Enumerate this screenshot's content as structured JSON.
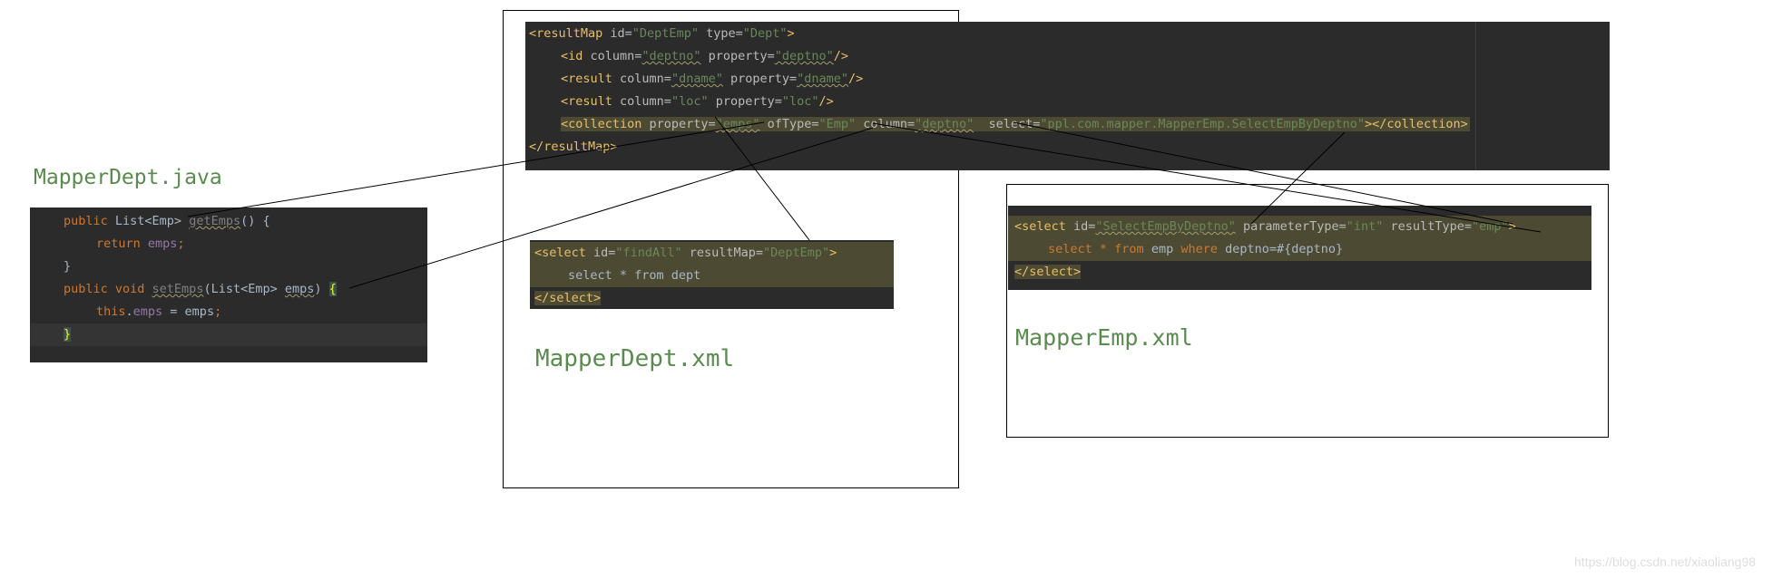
{
  "colors": {
    "editor_bg": "#2b2b2b",
    "tag": "#e8bf6a",
    "attr_name": "#bababa",
    "attr_value": "#6a8759",
    "keyword": "#cc7832",
    "field": "#9876aa",
    "plain": "#a9b7c6",
    "caption": "#5a8a4f"
  },
  "captions": {
    "java": "MapperDept.java",
    "dept_xml": "MapperDept.xml",
    "emp_xml": "MapperEmp.xml"
  },
  "result_map": {
    "l1_open": "<resultMap",
    "l1_id_attr": " id=",
    "l1_id_val": "\"DeptEmp\"",
    "l1_type_attr": " type=",
    "l1_type_val": "\"Dept\"",
    "l1_close": ">",
    "l2_open": "<id",
    "l2_col_attr": " column=",
    "l2_col_val": "\"deptno\"",
    "l2_prop_attr": " property=",
    "l2_prop_val": "\"deptno\"",
    "l2_close": "/>",
    "l3_open": "<result",
    "l3_col_attr": " column=",
    "l3_col_val": "\"dname\"",
    "l3_prop_attr": " property=",
    "l3_prop_val": "\"dname\"",
    "l3_close": "/>",
    "l4_open": "<result",
    "l4_col_attr": " column=",
    "l4_col_val": "\"loc\"",
    "l4_prop_attr": " property=",
    "l4_prop_val": "\"loc\"",
    "l4_close": "/>",
    "l5_open": "<collection",
    "l5_prop_attr": " property=",
    "l5_prop_val": "\"emps\"",
    "l5_of_attr": " ofType=",
    "l5_of_val": "\"Emp\"",
    "l5_col_attr": " column=",
    "l5_col_val": "\"deptno\"",
    "l5_sel_attr": "  select=",
    "l5_sel_val": "\"ppl.com.mapper.MapperEmp.SelectEmpByDeptno\"",
    "l5_close": "></collection>",
    "l6_close": "</resultMap>"
  },
  "java_code": {
    "l1_kw": "public ",
    "l1_type": "List<Emp> ",
    "l1_method": "getEmps",
    "l1_rest": "() {",
    "l2_kw": "return ",
    "l2_field": "emps",
    "l2_semi": ";",
    "l3": "}",
    "l4_kw": "public void ",
    "l4_method": "setEmps",
    "l4_params_open": "(List<Emp> ",
    "l4_param": "emps",
    "l4_params_close": ") ",
    "l4_brace": "{",
    "l5_kw": "this",
    "l5_dot": ".",
    "l5_field": "emps",
    "l5_rest": " = emps",
    "l5_semi": ";",
    "l6_brace": "}"
  },
  "select_findall": {
    "l1_open": "<select",
    "l1_id_attr": " id=",
    "l1_id_val": "\"findAll\"",
    "l1_rm_attr": " resultMap=",
    "l1_rm_val": "\"DeptEmp\"",
    "l1_close": ">",
    "l2": "select * from dept",
    "l3_close": "</select>"
  },
  "select_emp": {
    "l1_open": "<select",
    "l1_id_attr": " id=",
    "l1_id_val": "\"SelectEmpByDeptno\"",
    "l1_pt_attr": " parameterType=",
    "l1_pt_val": "\"int\"",
    "l1_rt_attr": " resultType=",
    "l1_rt_val": "\"emp\"",
    "l1_close": ">",
    "l2_kw1": "select",
    "l2_star": " * ",
    "l2_kw2": "from",
    "l2_mid": " emp ",
    "l2_kw3": "where",
    "l2_rest": " deptno=#{deptno}",
    "l3_close": "</select>"
  },
  "watermark": "https://blog.csdn.net/xiaoliang98"
}
